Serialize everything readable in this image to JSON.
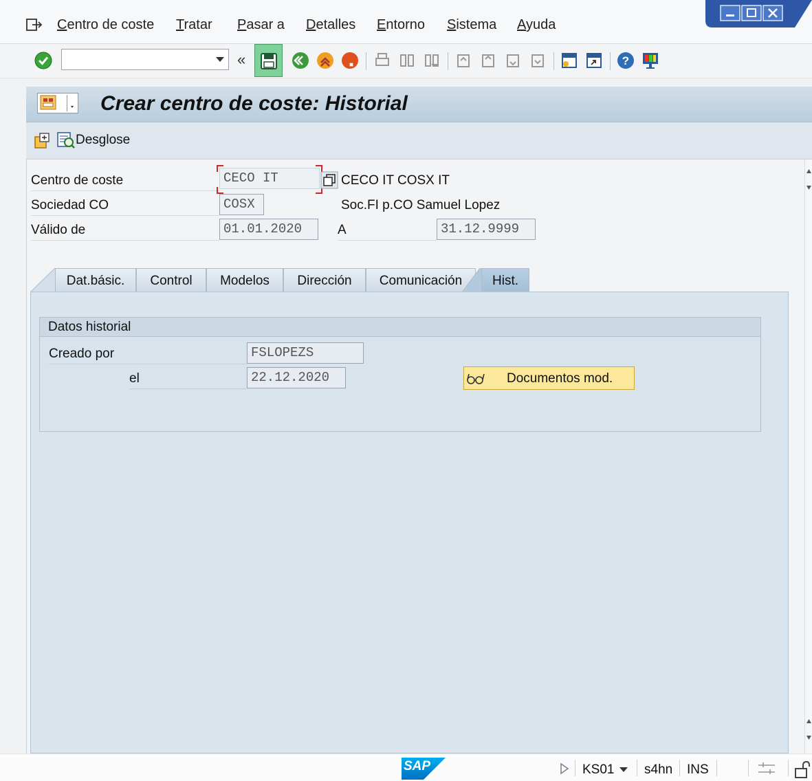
{
  "menu": {
    "items": [
      "Centro de coste",
      "Tratar",
      "Pasar a",
      "Detalles",
      "Entorno",
      "Sistema",
      "Ayuda"
    ]
  },
  "toolbar": {
    "command_value": "",
    "chevron": "«"
  },
  "title": {
    "text": "Crear centro de coste: Historial"
  },
  "app_toolbar": {
    "desglose_label": "Desglose"
  },
  "header_fields": {
    "cost_center_label": "Centro de coste",
    "cost_center_value": "CECO IT",
    "cost_center_desc": "CECO IT COSX IT",
    "company_label": "Sociedad CO",
    "company_value": "COSX",
    "company_desc": "Soc.FI p.CO Samuel Lopez",
    "valid_from_label": "Válido de",
    "valid_from_value": "01.01.2020",
    "valid_to_label": "A",
    "valid_to_value": "31.12.9999"
  },
  "tabs": [
    {
      "label": "Dat.básic."
    },
    {
      "label": "Control"
    },
    {
      "label": "Modelos"
    },
    {
      "label": "Dirección"
    },
    {
      "label": "Comunicación"
    },
    {
      "label": "Hist."
    }
  ],
  "history": {
    "group_title": "Datos historial",
    "created_by_label": "Creado por",
    "created_by_value": "FSLOPEZS",
    "on_label": "el",
    "on_value": "22.12.2020",
    "docs_button": "Documentos mod."
  },
  "status": {
    "transaction": "KS01",
    "system": "s4hn",
    "mode": "INS",
    "logo": "SAP"
  }
}
